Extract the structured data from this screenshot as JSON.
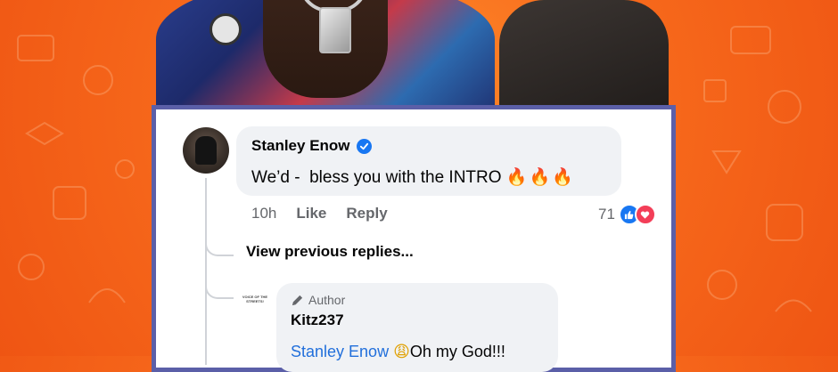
{
  "comment": {
    "author": "Stanley Enow",
    "text": "We’d -  bless you with the INTRO ",
    "emojis": "🔥🔥🔥",
    "time": "10h",
    "like_label": "Like",
    "reply_label": "Reply",
    "reaction_count": "71"
  },
  "thread": {
    "view_previous_label": "View previous replies..."
  },
  "reply": {
    "author_avatar_text": "VOICE OF THE STREETS!",
    "badge_label": "Author",
    "author": "Kitz237",
    "mention": "Stanley Enow",
    "emoji": "😩",
    "text": "Oh my God!!!"
  },
  "colors": {
    "background": "#f76a1c",
    "card_border": "#5b5fa8",
    "link_blue": "#216fdb",
    "verified_blue": "#1877f2",
    "love_red": "#f33e58"
  }
}
